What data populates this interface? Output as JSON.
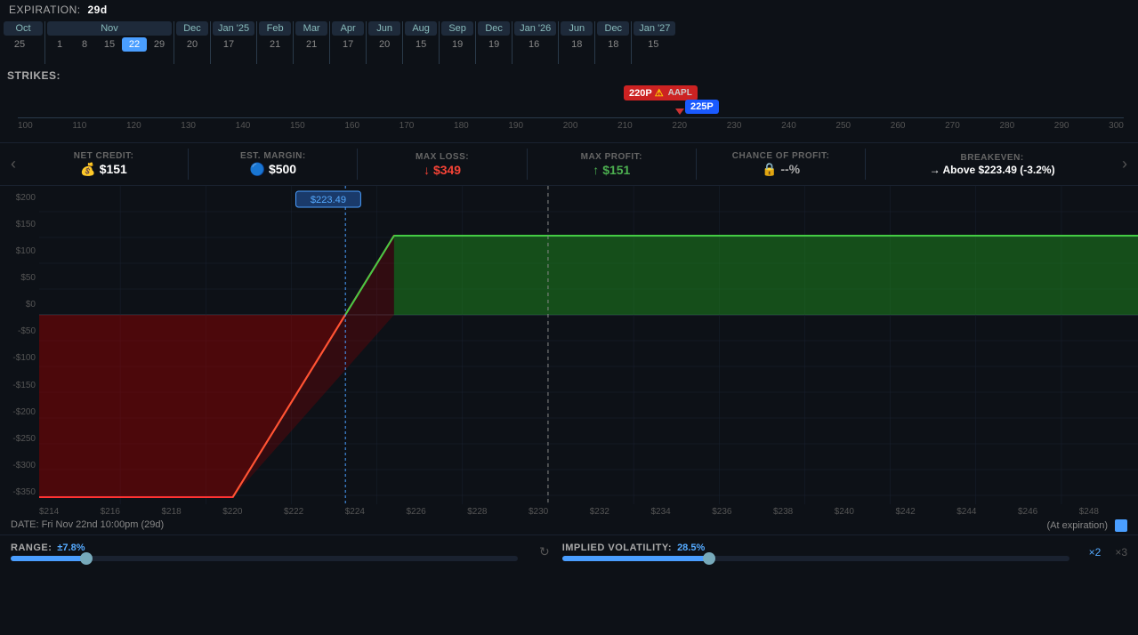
{
  "expiration": {
    "label": "EXPIRATION:",
    "days": "29d"
  },
  "months": [
    {
      "name": "Oct",
      "selected": true,
      "dates": [
        "25"
      ]
    },
    {
      "name": "Nov",
      "selected": false,
      "dates": [
        "1",
        "8",
        "15",
        "22",
        "29"
      ]
    },
    {
      "name": "Dec",
      "selected": false,
      "dates": [
        "20"
      ]
    },
    {
      "name": "Jan '25",
      "selected": false,
      "dates": [
        "17"
      ]
    },
    {
      "name": "Feb",
      "selected": false,
      "dates": [
        "21"
      ]
    },
    {
      "name": "Mar",
      "selected": false,
      "dates": [
        "21"
      ]
    },
    {
      "name": "Apr",
      "selected": false,
      "dates": [
        "17"
      ]
    },
    {
      "name": "Jun",
      "selected": false,
      "dates": [
        "20"
      ]
    },
    {
      "name": "Aug",
      "selected": false,
      "dates": [
        "15"
      ]
    },
    {
      "name": "Sep",
      "selected": false,
      "dates": [
        "19"
      ]
    },
    {
      "name": "Dec",
      "selected": false,
      "dates": [
        "19"
      ]
    },
    {
      "name": "Jan '26",
      "selected": false,
      "dates": [
        "16"
      ]
    },
    {
      "name": "Jun",
      "selected": false,
      "dates": [
        "18"
      ]
    },
    {
      "name": "Dec",
      "selected": false,
      "dates": [
        "18"
      ]
    },
    {
      "name": "Jan '27",
      "selected": false,
      "dates": [
        "15"
      ]
    }
  ],
  "selected_date": "22",
  "strikes_label": "STRIKES:",
  "strike_prices": [
    "100",
    "110",
    "120",
    "130",
    "140",
    "150",
    "160",
    "170",
    "180",
    "190",
    "200",
    "210",
    "220",
    "230",
    "240",
    "250",
    "260",
    "270",
    "280",
    "290",
    "300"
  ],
  "strike_220": "220P",
  "strike_225": "225P",
  "ticker": "AAPL",
  "stats": {
    "net_credit": {
      "label": "NET CREDIT:",
      "value": "$151",
      "icon": "💰"
    },
    "est_margin": {
      "label": "EST. MARGIN:",
      "value": "$500",
      "icon": "🔵"
    },
    "max_loss": {
      "label": "MAX LOSS:",
      "value": "$349",
      "direction": "down",
      "color": "red"
    },
    "max_profit": {
      "label": "MAX PROFIT:",
      "value": "$151",
      "direction": "up",
      "color": "green"
    },
    "chance_of_profit": {
      "label": "CHANCE OF PROFIT:",
      "value": "--%",
      "icon": "🔒"
    },
    "breakeven": {
      "label": "BREAKEVEN:",
      "value": "Above $223.49 (-3.2%)",
      "arrow": "→"
    }
  },
  "chart": {
    "price_annotation": "$223.49",
    "y_labels": [
      "$200",
      "$150",
      "$100",
      "$50",
      "$0",
      "-$50",
      "-$100",
      "-$150",
      "-$200",
      "-$250",
      "-$300",
      "-$350"
    ],
    "x_labels": [
      "$214",
      "$216",
      "$218",
      "$220",
      "$222",
      "$224",
      "$226",
      "$228",
      "$230",
      "$232",
      "$234",
      "$236",
      "$238",
      "$240",
      "$242",
      "$244",
      "$246",
      "$248"
    ]
  },
  "bottom": {
    "date_str": "DATE: Fri Nov 22nd 10:00pm (29d)",
    "at_exp": "(At expiration)"
  },
  "range": {
    "label": "RANGE:",
    "value": "±7.8%",
    "thumb_pct": 15
  },
  "iv": {
    "label": "IMPLIED VOLATILITY:",
    "value": "28.5%",
    "thumb_pct": 29
  },
  "multipliers": [
    "×2",
    "×3"
  ]
}
